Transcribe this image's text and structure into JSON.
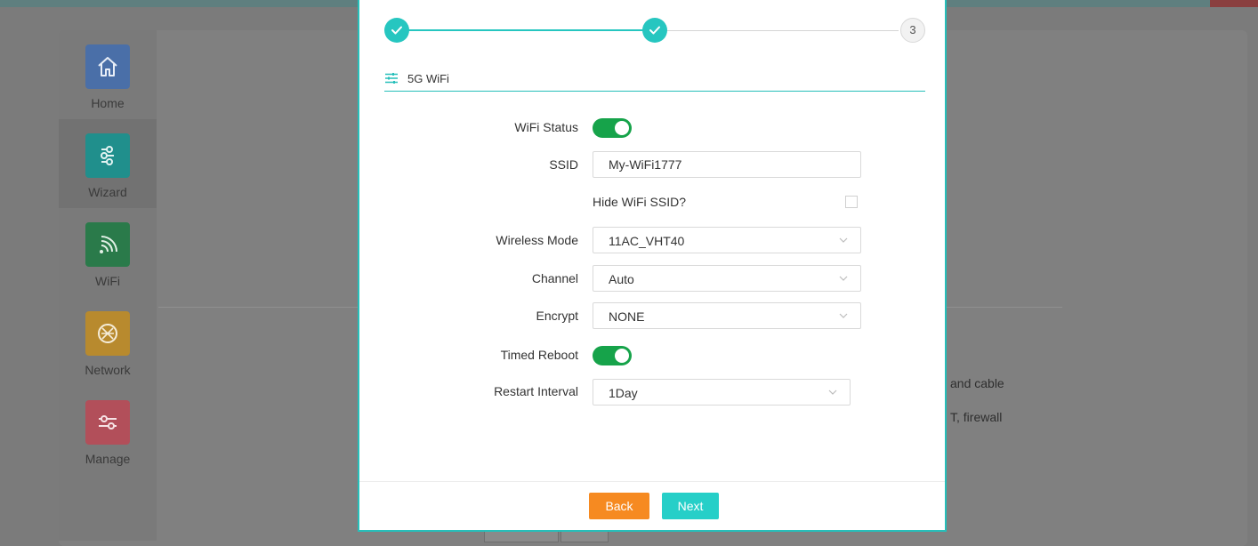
{
  "sidebar": {
    "items": [
      {
        "label": "Home",
        "icon": "home-icon",
        "color": "#4a6fa8"
      },
      {
        "label": "Wizard",
        "icon": "wizard-icon",
        "color": "#208f8c"
      },
      {
        "label": "WiFi",
        "icon": "wifi-icon",
        "color": "#2a7a4a"
      },
      {
        "label": "Network",
        "icon": "network-icon",
        "color": "#b88a2e"
      },
      {
        "label": "Manage",
        "icon": "manage-icon",
        "color": "#b24f5a"
      }
    ]
  },
  "background_text": {
    "line1": "and cable",
    "line2": "T,  firewall"
  },
  "wizard": {
    "steps": [
      {
        "state": "done"
      },
      {
        "state": "done"
      },
      {
        "state": "todo",
        "number": "3"
      }
    ],
    "section_title": "5G WiFi",
    "fields": {
      "wifi_status_label": "WiFi Status",
      "wifi_status_on": true,
      "ssid_label": "SSID",
      "ssid_value": "My-WiFi1777",
      "hide_ssid_label": "Hide WiFi SSID?",
      "hide_ssid_checked": false,
      "wireless_mode_label": "Wireless Mode",
      "wireless_mode_value": "11AC_VHT40",
      "channel_label": "Channel",
      "channel_value": "Auto",
      "encrypt_label": "Encrypt",
      "encrypt_value": "NONE",
      "timed_reboot_label": "Timed Reboot",
      "timed_reboot_on": true,
      "restart_interval_label": "Restart Interval",
      "restart_interval_value": "1Day"
    },
    "buttons": {
      "back": "Back",
      "next": "Next"
    }
  },
  "colors": {
    "accent": "#26bfba",
    "toggle_on": "#16a34a",
    "back_button": "#f68a21",
    "next_button": "#26cfc8"
  }
}
